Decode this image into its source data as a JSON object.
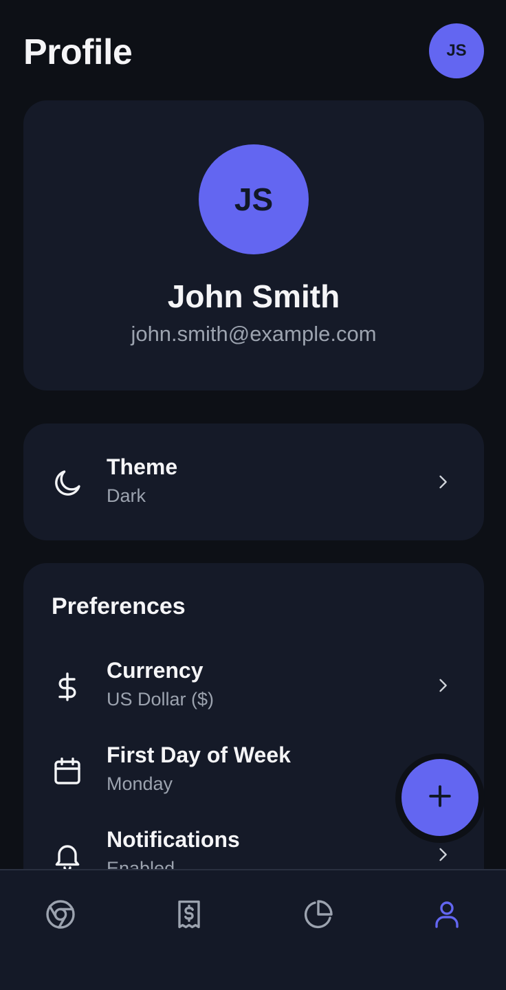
{
  "header": {
    "title": "Profile",
    "avatar_initials": "JS"
  },
  "profile": {
    "initials": "JS",
    "name": "John Smith",
    "email": "john.smith@example.com"
  },
  "theme": {
    "label": "Theme",
    "value": "Dark",
    "icon": "moon-icon"
  },
  "preferences": {
    "title": "Preferences",
    "items": [
      {
        "label": "Currency",
        "value": "US Dollar ($)",
        "icon": "dollar-icon"
      },
      {
        "label": "First Day of Week",
        "value": "Monday",
        "icon": "calendar-icon"
      },
      {
        "label": "Notifications",
        "value": "Enabled",
        "icon": "bell-icon"
      }
    ]
  },
  "fab": {
    "icon": "plus-icon"
  },
  "nav": {
    "items": [
      {
        "name": "dashboard",
        "icon": "chrome-icon",
        "active": false
      },
      {
        "name": "transactions",
        "icon": "receipt-icon",
        "active": false
      },
      {
        "name": "reports",
        "icon": "pie-chart-icon",
        "active": false
      },
      {
        "name": "profile",
        "icon": "user-icon",
        "active": true
      }
    ]
  },
  "colors": {
    "accent": "#6366f1",
    "background": "#0d1016",
    "card": "#151a28",
    "muted": "#9ca3af"
  }
}
